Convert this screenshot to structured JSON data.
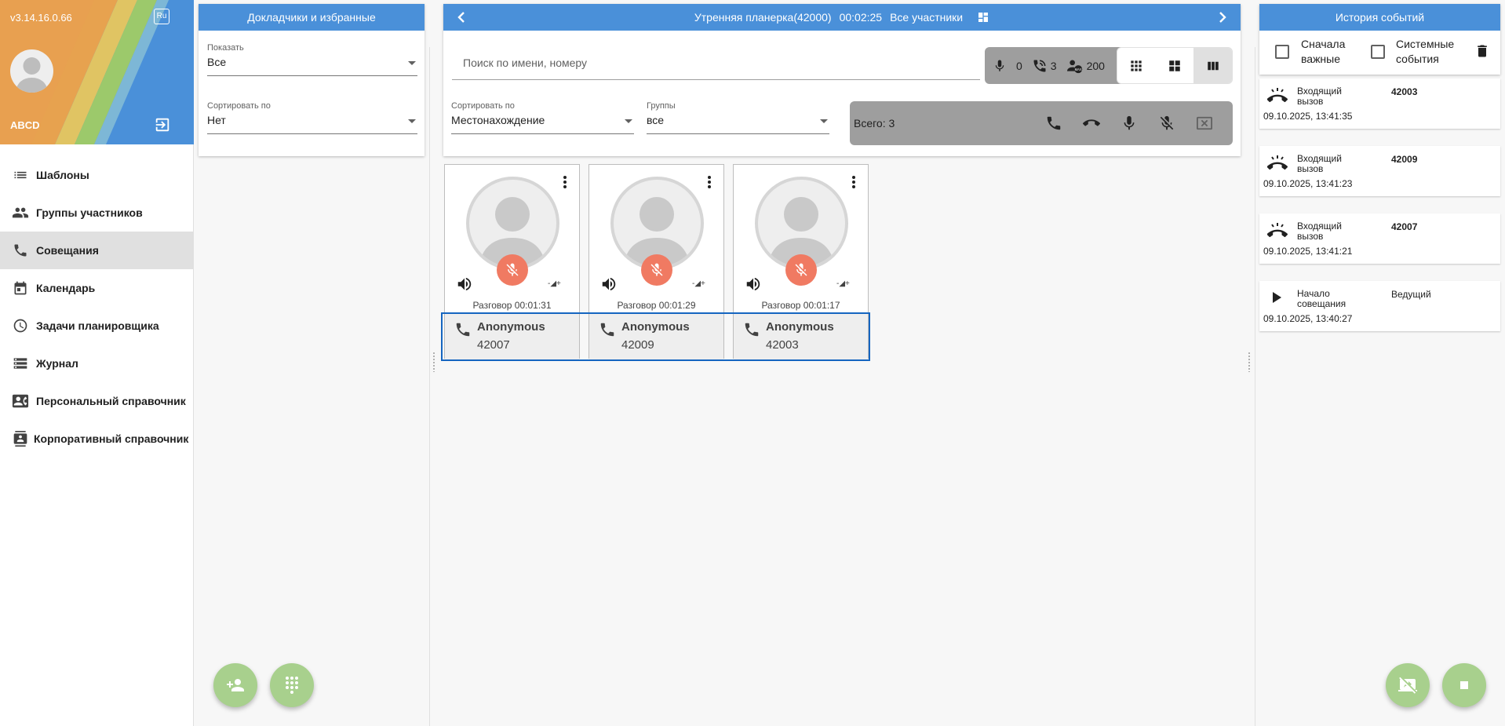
{
  "sidebar": {
    "version": "v3.14.16.0.66",
    "lang": "Ru",
    "user": "ABCD",
    "items": [
      {
        "label": "Шаблоны"
      },
      {
        "label": "Группы участников"
      },
      {
        "label": "Совещания"
      },
      {
        "label": "Календарь"
      },
      {
        "label": "Задачи планировщика"
      },
      {
        "label": "Журнал"
      },
      {
        "label": "Персональный справочник"
      },
      {
        "label": "Корпоративный справочник"
      }
    ]
  },
  "speakers": {
    "title": "Докладчики и избранные",
    "show_label": "Показать",
    "show_value": "Все",
    "sort_label": "Сортировать по",
    "sort_value": "Нет"
  },
  "conference": {
    "title": "Утренняя планерка(42000)",
    "timer": "00:02:25",
    "participants_label": "Все участники",
    "search_placeholder": "Поиск по имени, номеру",
    "stats": {
      "mic": "0",
      "calls": "3",
      "max": "200"
    },
    "sort_label": "Сортировать по",
    "sort_value": "Местонахождение",
    "groups_label": "Группы",
    "groups_value": "все",
    "total": "Всего: 3",
    "participants": [
      {
        "name": "Anonymous",
        "number": "42007",
        "duration": "Разговор 00:01:31"
      },
      {
        "name": "Anonymous",
        "number": "42009",
        "duration": "Разговор 00:01:29"
      },
      {
        "name": "Anonymous",
        "number": "42003",
        "duration": "Разговор 00:01:17"
      }
    ]
  },
  "history": {
    "title": "История событий",
    "important_first": "Сначала важные",
    "system_events": "Системные события",
    "events": [
      {
        "type": "Входящий вызов",
        "value": "42003",
        "time": "09.10.2025, 13:41:35"
      },
      {
        "type": "Входящий вызов",
        "value": "42009",
        "time": "09.10.2025, 13:41:23"
      },
      {
        "type": "Входящий вызов",
        "value": "42007",
        "time": "09.10.2025, 13:41:21"
      },
      {
        "type": "Начало совещания",
        "value": "Ведущий",
        "time": "09.10.2025, 13:40:27"
      }
    ]
  },
  "colors": {
    "primary": "#4a90d9",
    "fab": "#a8d08d",
    "mute": "#f07a62",
    "selection": "#1565c0"
  }
}
